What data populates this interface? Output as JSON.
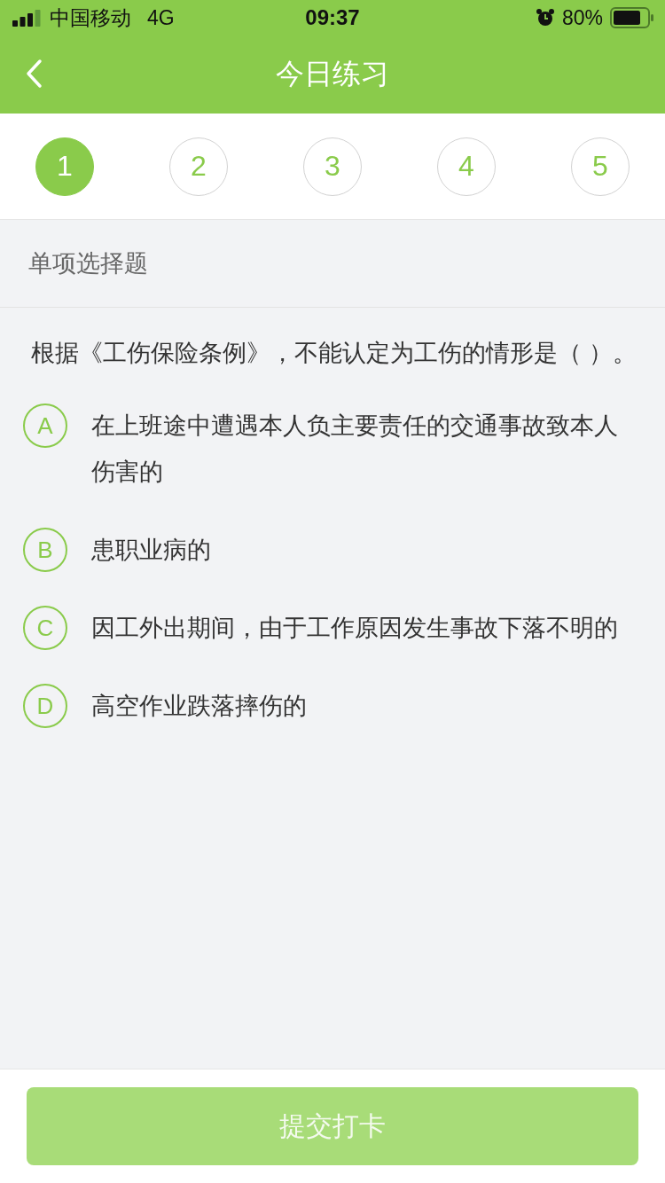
{
  "status_bar": {
    "carrier": "中国移动",
    "network": "4G",
    "time": "09:37",
    "battery": "80%"
  },
  "nav_bar": {
    "title": "今日练习"
  },
  "steps": [
    {
      "label": "1",
      "selected": true
    },
    {
      "label": "2",
      "selected": false
    },
    {
      "label": "3",
      "selected": false
    },
    {
      "label": "4",
      "selected": false
    },
    {
      "label": "5",
      "selected": false
    }
  ],
  "section": {
    "title": "单项选择题"
  },
  "question": {
    "text": "根据《工伤保险条例》，不能认定为工伤的情形是（ ）。"
  },
  "options": [
    {
      "letter": "A",
      "text": "在上班途中遭遇本人负主要责任的交通事故致本人伤害的",
      "selected": false
    },
    {
      "letter": "B",
      "text": "患职业病的",
      "selected": false
    },
    {
      "letter": "C",
      "text": "因工外出期间，由于工作原因发生事故下落不明的",
      "selected": false
    },
    {
      "letter": "D",
      "text": "高空作业跌落摔伤的",
      "selected": false
    }
  ],
  "submit_button": {
    "label": "提交打卡",
    "disabled": true
  }
}
